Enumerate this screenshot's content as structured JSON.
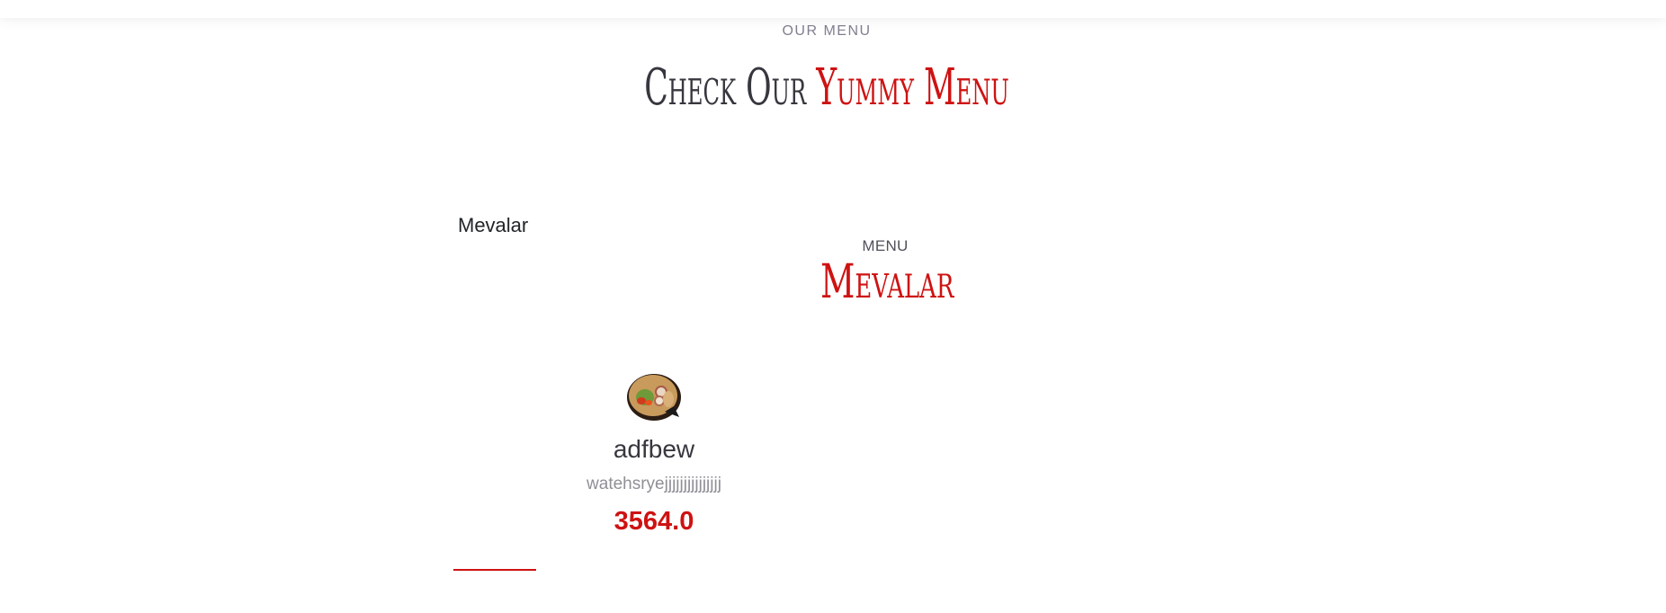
{
  "section": {
    "eyebrow": "OUR MENU",
    "title_lead": "Check Our",
    "title_accent": "Yummy Menu"
  },
  "tabs": {
    "items": [
      {
        "label": "Mevalar"
      }
    ]
  },
  "tab_content": {
    "label": "MENU",
    "title": "Mevalar"
  },
  "menu_items": [
    {
      "image_icon": "food-bowl-image",
      "name": "adfbew",
      "ingredients": "watehsryejjjjjjjjjjjjjjj",
      "price": "3564.0"
    }
  ],
  "colors": {
    "accent": "#ce1212",
    "heading": "#37373f",
    "muted": "#8f8f96"
  }
}
